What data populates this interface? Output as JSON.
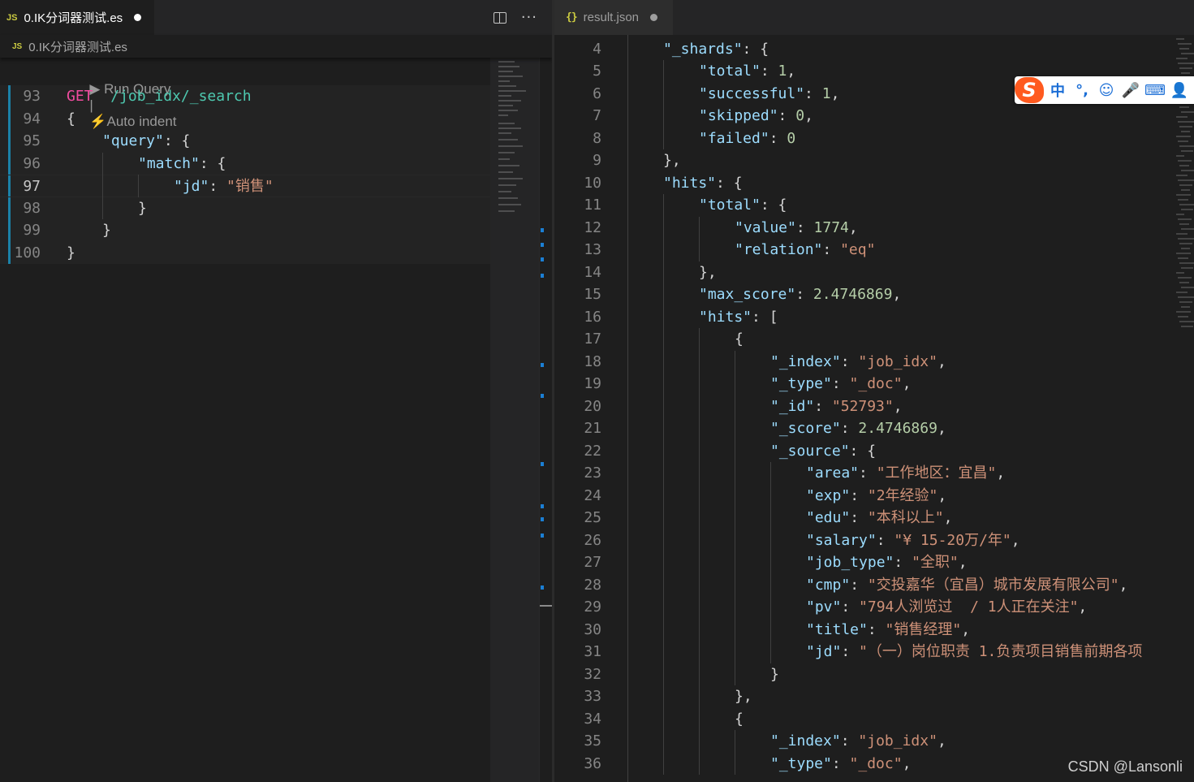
{
  "left_tab": {
    "badge": "JS",
    "title": "0.IK分词器测试.es"
  },
  "left_breadcrumb": {
    "badge": "JS",
    "file": "0.IK分词器测试.es"
  },
  "left_codelens": {
    "run_query": "▶ Run Query",
    "separator": "|",
    "auto_indent": "⚡Auto indent"
  },
  "left_lines": [
    {
      "num": "93",
      "indent": 0,
      "parts": [
        [
          "GET",
          "get"
        ],
        [
          "  ",
          "punc"
        ],
        [
          "/job_idx/_search",
          "url"
        ]
      ]
    },
    {
      "num": "94",
      "indent": 0,
      "parts": [
        [
          "{",
          "punc"
        ]
      ]
    },
    {
      "num": "95",
      "indent": 1,
      "parts": [
        [
          "\"query\"",
          "key"
        ],
        [
          ": {",
          "punc"
        ]
      ]
    },
    {
      "num": "96",
      "indent": 2,
      "parts": [
        [
          "\"match\"",
          "key"
        ],
        [
          ": ",
          "punc"
        ],
        [
          "{",
          "punc"
        ]
      ]
    },
    {
      "num": "97",
      "indent": 3,
      "parts": [
        [
          "\"jd\"",
          "key"
        ],
        [
          ": ",
          "punc"
        ],
        [
          "\"销售\"",
          "str"
        ]
      ],
      "active": true
    },
    {
      "num": "98",
      "indent": 2,
      "parts": [
        [
          "}",
          "punc"
        ]
      ]
    },
    {
      "num": "99",
      "indent": 1,
      "parts": [
        [
          "}",
          "punc"
        ]
      ]
    },
    {
      "num": "100",
      "indent": 0,
      "parts": [
        [
          "}",
          "punc"
        ]
      ]
    }
  ],
  "right_tab": {
    "badge": "{}",
    "title": "result.json"
  },
  "right_lines": [
    {
      "num": "4",
      "indent": 2,
      "parts": [
        [
          "\"_shards\"",
          "key"
        ],
        [
          ": {",
          "punc"
        ]
      ]
    },
    {
      "num": "5",
      "indent": 3,
      "parts": [
        [
          "\"total\"",
          "key"
        ],
        [
          ": ",
          "punc"
        ],
        [
          "1",
          "num"
        ],
        [
          ",",
          "punc"
        ]
      ]
    },
    {
      "num": "6",
      "indent": 3,
      "parts": [
        [
          "\"successful\"",
          "key"
        ],
        [
          ": ",
          "punc"
        ],
        [
          "1",
          "num"
        ],
        [
          ",",
          "punc"
        ]
      ]
    },
    {
      "num": "7",
      "indent": 3,
      "parts": [
        [
          "\"skipped\"",
          "key"
        ],
        [
          ": ",
          "punc"
        ],
        [
          "0",
          "num"
        ],
        [
          ",",
          "punc"
        ]
      ]
    },
    {
      "num": "8",
      "indent": 3,
      "parts": [
        [
          "\"failed\"",
          "key"
        ],
        [
          ": ",
          "punc"
        ],
        [
          "0",
          "num"
        ]
      ]
    },
    {
      "num": "9",
      "indent": 2,
      "parts": [
        [
          "},",
          "punc"
        ]
      ]
    },
    {
      "num": "10",
      "indent": 2,
      "parts": [
        [
          "\"hits\"",
          "key"
        ],
        [
          ": {",
          "punc"
        ]
      ]
    },
    {
      "num": "11",
      "indent": 3,
      "parts": [
        [
          "\"total\"",
          "key"
        ],
        [
          ": {",
          "punc"
        ]
      ]
    },
    {
      "num": "12",
      "indent": 4,
      "parts": [
        [
          "\"value\"",
          "key"
        ],
        [
          ": ",
          "punc"
        ],
        [
          "1774",
          "num"
        ],
        [
          ",",
          "punc"
        ]
      ]
    },
    {
      "num": "13",
      "indent": 4,
      "parts": [
        [
          "\"relation\"",
          "key"
        ],
        [
          ": ",
          "punc"
        ],
        [
          "\"eq\"",
          "str"
        ]
      ]
    },
    {
      "num": "14",
      "indent": 3,
      "parts": [
        [
          "},",
          "punc"
        ]
      ]
    },
    {
      "num": "15",
      "indent": 3,
      "parts": [
        [
          "\"max_score\"",
          "key"
        ],
        [
          ": ",
          "punc"
        ],
        [
          "2.4746869",
          "num"
        ],
        [
          ",",
          "punc"
        ]
      ]
    },
    {
      "num": "16",
      "indent": 3,
      "parts": [
        [
          "\"hits\"",
          "key"
        ],
        [
          ": [",
          "punc"
        ]
      ]
    },
    {
      "num": "17",
      "indent": 4,
      "parts": [
        [
          "{",
          "punc"
        ]
      ]
    },
    {
      "num": "18",
      "indent": 5,
      "parts": [
        [
          "\"_index\"",
          "key"
        ],
        [
          ": ",
          "punc"
        ],
        [
          "\"job_idx\"",
          "str"
        ],
        [
          ",",
          "punc"
        ]
      ]
    },
    {
      "num": "19",
      "indent": 5,
      "parts": [
        [
          "\"_type\"",
          "key"
        ],
        [
          ": ",
          "punc"
        ],
        [
          "\"_doc\"",
          "str"
        ],
        [
          ",",
          "punc"
        ]
      ]
    },
    {
      "num": "20",
      "indent": 5,
      "parts": [
        [
          "\"_id\"",
          "key"
        ],
        [
          ": ",
          "punc"
        ],
        [
          "\"52793\"",
          "str"
        ],
        [
          ",",
          "punc"
        ]
      ]
    },
    {
      "num": "21",
      "indent": 5,
      "parts": [
        [
          "\"_score\"",
          "key"
        ],
        [
          ": ",
          "punc"
        ],
        [
          "2.4746869",
          "num"
        ],
        [
          ",",
          "punc"
        ]
      ]
    },
    {
      "num": "22",
      "indent": 5,
      "parts": [
        [
          "\"_source\"",
          "key"
        ],
        [
          ": {",
          "punc"
        ]
      ]
    },
    {
      "num": "23",
      "indent": 6,
      "parts": [
        [
          "\"area\"",
          "key"
        ],
        [
          ": ",
          "punc"
        ],
        [
          "\"工作地区：宜昌\"",
          "str"
        ],
        [
          ",",
          "punc"
        ]
      ]
    },
    {
      "num": "24",
      "indent": 6,
      "parts": [
        [
          "\"exp\"",
          "key"
        ],
        [
          ": ",
          "punc"
        ],
        [
          "\"2年经验\"",
          "str"
        ],
        [
          ",",
          "punc"
        ]
      ]
    },
    {
      "num": "25",
      "indent": 6,
      "parts": [
        [
          "\"edu\"",
          "key"
        ],
        [
          ": ",
          "punc"
        ],
        [
          "\"本科以上\"",
          "str"
        ],
        [
          ",",
          "punc"
        ]
      ]
    },
    {
      "num": "26",
      "indent": 6,
      "parts": [
        [
          "\"salary\"",
          "key"
        ],
        [
          ": ",
          "punc"
        ],
        [
          "\"¥ 15-20万/年\"",
          "str"
        ],
        [
          ",",
          "punc"
        ]
      ]
    },
    {
      "num": "27",
      "indent": 6,
      "parts": [
        [
          "\"job_type\"",
          "key"
        ],
        [
          ": ",
          "punc"
        ],
        [
          "\"全职\"",
          "str"
        ],
        [
          ",",
          "punc"
        ]
      ]
    },
    {
      "num": "28",
      "indent": 6,
      "parts": [
        [
          "\"cmp\"",
          "key"
        ],
        [
          ": ",
          "punc"
        ],
        [
          "\"交投嘉华（宜昌）城市发展有限公司\"",
          "str"
        ],
        [
          ",",
          "punc"
        ]
      ]
    },
    {
      "num": "29",
      "indent": 6,
      "parts": [
        [
          "\"pv\"",
          "key"
        ],
        [
          ": ",
          "punc"
        ],
        [
          "\"794人浏览过  / 1人正在关注\"",
          "str"
        ],
        [
          ",",
          "punc"
        ]
      ]
    },
    {
      "num": "30",
      "indent": 6,
      "parts": [
        [
          "\"title\"",
          "key"
        ],
        [
          ": ",
          "punc"
        ],
        [
          "\"销售经理\"",
          "str"
        ],
        [
          ",",
          "punc"
        ]
      ]
    },
    {
      "num": "31",
      "indent": 6,
      "parts": [
        [
          "\"jd\"",
          "key"
        ],
        [
          ": ",
          "punc"
        ],
        [
          "\"（一）岗位职责 1.负责项目销售前期各项",
          "str"
        ]
      ]
    },
    {
      "num": "32",
      "indent": 5,
      "parts": [
        [
          "}",
          "punc"
        ]
      ]
    },
    {
      "num": "33",
      "indent": 4,
      "parts": [
        [
          "},",
          "punc"
        ]
      ]
    },
    {
      "num": "34",
      "indent": 4,
      "parts": [
        [
          "{",
          "punc"
        ]
      ]
    },
    {
      "num": "35",
      "indent": 5,
      "parts": [
        [
          "\"_index\"",
          "key"
        ],
        [
          ": ",
          "punc"
        ],
        [
          "\"job_idx\"",
          "str"
        ],
        [
          ",",
          "punc"
        ]
      ]
    },
    {
      "num": "36",
      "indent": 5,
      "parts": [
        [
          "\"_type\"",
          "key"
        ],
        [
          ": ",
          "punc"
        ],
        [
          "\"_doc\"",
          "str"
        ],
        [
          ",",
          "punc"
        ]
      ]
    }
  ],
  "ime": {
    "logo": "S",
    "items": [
      "中",
      "°,",
      "☺",
      "🎤",
      "⌨",
      "👤"
    ]
  },
  "watermark": "CSDN @Lansonli",
  "colors": {
    "get": "#f14c9f",
    "url": "#4ec9b0",
    "key": "#9cdcfe",
    "str": "#ce9178",
    "num": "#b5cea8",
    "punc": "#d4d4d4",
    "ime_logo": "#ff5a1f",
    "ime_icon": "#1b6ed6"
  }
}
